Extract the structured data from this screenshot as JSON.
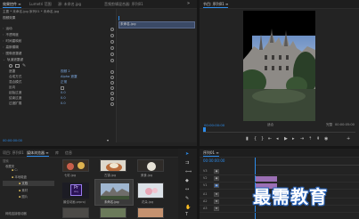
{
  "effect_controls": {
    "tabs": [
      "效果控件 ≡",
      "Lumetri 范围",
      "源: 未命名.jpg",
      "音频剪辑混合器: 序列01"
    ],
    "breadcrumb": "主要 * 未命名.jpg  序列01 * 未命名.jpg",
    "section_video": "视频效果",
    "rows": [
      {
        "label": "运动",
        "chev": "›"
      },
      {
        "label": "不透明度",
        "chev": "›"
      },
      {
        "label": "时间重映射",
        "chev": "›"
      },
      {
        "label": "高斯模糊",
        "chev": "›"
      },
      {
        "label": "图像遮罩键",
        "chev": "›"
      },
      {
        "label": "轨道遮罩键",
        "chev": "⌄"
      }
    ],
    "sub_rows": [
      {
        "label": "遮罩",
        "value": "视频 2"
      },
      {
        "label": "合成方式",
        "value": "Alpha 遮罩"
      },
      {
        "label": "混合模式",
        "value": "正常"
      },
      {
        "label": "反向",
        "value": ""
      },
      {
        "label": "起始过渡",
        "value": "0.0"
      },
      {
        "label": "结束过渡",
        "value": "0.0"
      },
      {
        "label": "过渡扩展",
        "value": "0.0"
      }
    ],
    "clip_label": "未命名.jpg",
    "timecode": "00:00:00:00"
  },
  "program_monitor": {
    "tab": "节目: 序列01 ≡",
    "timecode_left": "00:00:00:00",
    "fit": "适合",
    "quality": "完整",
    "timecode_right": "00:00:05:00"
  },
  "project_panel": {
    "tabs": [
      "项目: 序列01",
      "媒体浏览器 ≡",
      "库",
      "信息"
    ],
    "search_placeholder": "搜索",
    "tree_label": "收藏夹",
    "items": [
      {
        "label": "C:"
      },
      {
        "label": "本地磁盘"
      },
      {
        "label": "文档"
      },
      {
        "label": "素材"
      },
      {
        "label": "图片"
      }
    ],
    "thumbs": [
      {
        "label": "七彩.jpg"
      },
      {
        "label": "古镇.jpg"
      },
      {
        "label": "美食.jpg"
      },
      {
        "label": "最佳动画.prproj"
      },
      {
        "label": "未命名.jpg"
      },
      {
        "label": "花朵.jpg"
      }
    ],
    "bottom_label": "网络连接驱动器"
  },
  "timeline": {
    "tab": "序列01 ≡",
    "timecode": "00:00:00:00",
    "tracks": [
      "V3",
      "V2",
      "V1",
      "A1",
      "A2",
      "A3"
    ],
    "watermark": "最需教育"
  }
}
